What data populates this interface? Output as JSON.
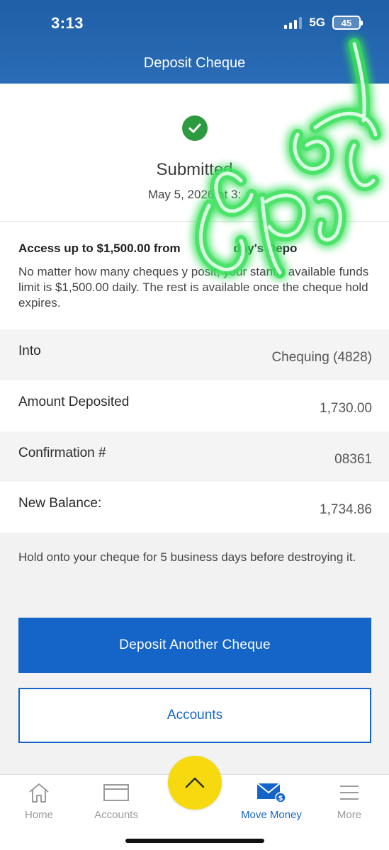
{
  "status_bar": {
    "time": "3:13",
    "network": "5G",
    "battery": "45"
  },
  "header": {
    "title": "Deposit Cheque"
  },
  "summary": {
    "status": "Submitted",
    "date": "May 5, 2026 at 3:"
  },
  "info": {
    "title": "Access up to $1,500.00 from",
    "title_tail": "day's Depo",
    "body": "No matter how many cheques y     posit, your    stantly available funds limit is $1,500.00 daily. The rest is available once the cheque hold expires."
  },
  "details": [
    {
      "label": "Into",
      "value": "Chequing (4828)"
    },
    {
      "label": "Amount Deposited",
      "value": "1,730.00"
    },
    {
      "label": "Confirmation #",
      "value": "08361"
    },
    {
      "label": "New Balance:",
      "value": "1,734.86"
    }
  ],
  "hold_note": "Hold onto your cheque for 5 business days before destroying it.",
  "buttons": {
    "primary": "Deposit Another Cheque",
    "secondary": "Accounts"
  },
  "tabbar": {
    "items": [
      {
        "label": "Home",
        "icon": "home-icon"
      },
      {
        "label": "Accounts",
        "icon": "wallet-icon"
      },
      {
        "label": "Move Money",
        "icon": "mail-dollar-icon",
        "active": true
      },
      {
        "label": "More",
        "icon": "menu-icon"
      }
    ],
    "fab_icon": "chevron-up-icon"
  },
  "colors": {
    "header_blue": "#2a6cb6",
    "primary_blue": "#1565c8",
    "success_green": "#2e9a3f",
    "fab_yellow": "#f6d90f",
    "overlay_green": "#39e05a"
  }
}
